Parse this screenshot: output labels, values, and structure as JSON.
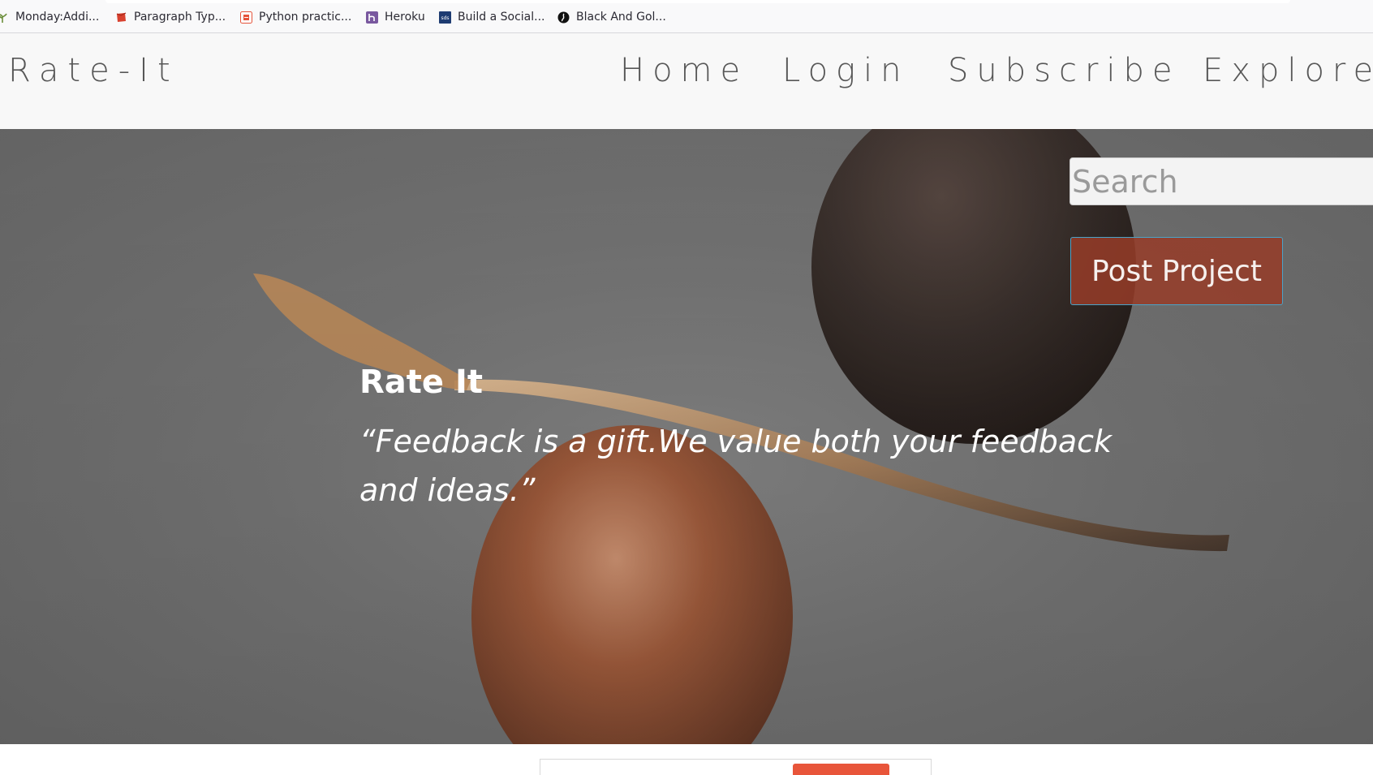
{
  "bookmarks": [
    {
      "label": "Monday:Addi...",
      "icon": "plant-icon",
      "color": "#6b8e3a"
    },
    {
      "label": "Paragraph Typ...",
      "icon": "red-box-icon",
      "color": "#d8412f"
    },
    {
      "label": "Python practic...",
      "icon": "python-logo-icon",
      "color": "#e5533a"
    },
    {
      "label": "Heroku",
      "icon": "heroku-icon",
      "color": "#79589f"
    },
    {
      "label": "Build a Social...",
      "icon": "dev-icon",
      "color": "#1e3c72"
    },
    {
      "label": "Black And Gol...",
      "icon": "circle-logo-icon",
      "color": "#111111"
    }
  ],
  "site": {
    "brand": "Rate-It",
    "nav": [
      "Home",
      "Login",
      "Subscribe",
      "Explore"
    ]
  },
  "search": {
    "placeholder": "Search"
  },
  "post_button": "Post Project",
  "hero": {
    "title": "Rate It",
    "quote": "“Feedback is a gift.We value both your feedback and ideas.”"
  },
  "colors": {
    "accent": "#e8553a",
    "button_bg": "#963c28",
    "text_grey": "#575757"
  }
}
